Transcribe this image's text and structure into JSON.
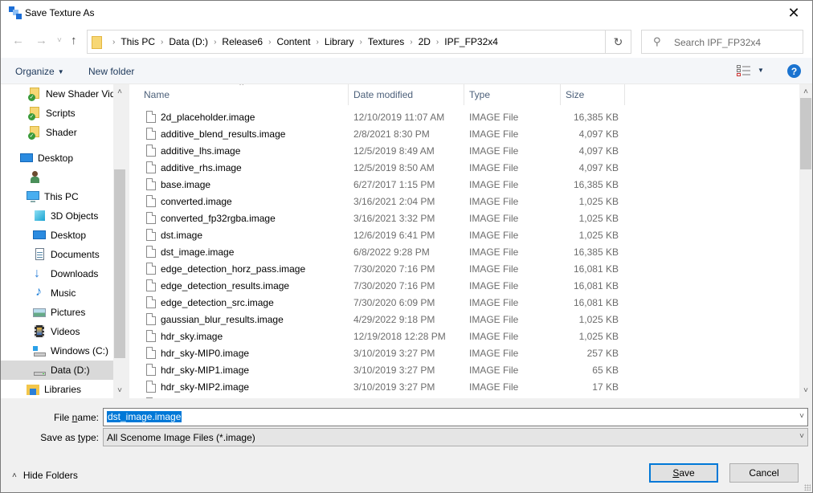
{
  "window": {
    "title": "Save Texture As",
    "close_label": "✕"
  },
  "nav": {
    "back_icon": "←",
    "forward_icon": "→",
    "recent_icon": "˅",
    "up_icon": "↑",
    "breadcrumbs": [
      "This PC",
      "Data (D:)",
      "Release6",
      "Content",
      "Library",
      "Textures",
      "2D",
      "IPF_FP32x4"
    ],
    "crumb_separator": "›",
    "dropdown_icon": "˅",
    "refresh_icon": "↻",
    "search_icon": "⚲",
    "search_placeholder": "Search IPF_FP32x4"
  },
  "toolbar": {
    "organize_label": "Organize",
    "organize_caret": "▼",
    "new_folder_label": "New folder",
    "view_caret": "▼",
    "help_label": "?"
  },
  "sidebar": {
    "items": [
      {
        "label": "New Shader Videos",
        "icon": "folder-synced-icon"
      },
      {
        "label": "Scripts",
        "icon": "folder-synced-icon"
      },
      {
        "label": "Shader",
        "icon": "folder-synced-icon"
      },
      {
        "label": "Desktop",
        "icon": "desktop-icon"
      },
      {
        "label": "",
        "icon": "user-icon"
      },
      {
        "label": "This PC",
        "icon": "computer-icon"
      },
      {
        "label": "3D Objects",
        "icon": "3d-objects-icon"
      },
      {
        "label": "Desktop",
        "icon": "desktop-icon"
      },
      {
        "label": "Documents",
        "icon": "documents-icon"
      },
      {
        "label": "Downloads",
        "icon": "downloads-icon"
      },
      {
        "label": "Music",
        "icon": "music-icon"
      },
      {
        "label": "Pictures",
        "icon": "pictures-icon"
      },
      {
        "label": "Videos",
        "icon": "videos-icon"
      },
      {
        "label": "Windows (C:)",
        "icon": "windows-drive-icon"
      },
      {
        "label": "Data (D:)",
        "icon": "drive-icon",
        "selected": true
      },
      {
        "label": "Libraries",
        "icon": "libraries-icon"
      }
    ],
    "scroll_up": "˄",
    "scroll_down": "˅"
  },
  "filelist": {
    "sort_caret": "˄",
    "columns": {
      "name": "Name",
      "date": "Date modified",
      "type": "Type",
      "size": "Size"
    },
    "files": [
      {
        "name": "2d_placeholder.image",
        "date": "12/10/2019 11:07 AM",
        "type": "IMAGE File",
        "size": "16,385 KB"
      },
      {
        "name": "additive_blend_results.image",
        "date": "2/8/2021 8:30 PM",
        "type": "IMAGE File",
        "size": "4,097 KB"
      },
      {
        "name": "additive_lhs.image",
        "date": "12/5/2019 8:49 AM",
        "type": "IMAGE File",
        "size": "4,097 KB"
      },
      {
        "name": "additive_rhs.image",
        "date": "12/5/2019 8:50 AM",
        "type": "IMAGE File",
        "size": "4,097 KB"
      },
      {
        "name": "base.image",
        "date": "6/27/2017 1:15 PM",
        "type": "IMAGE File",
        "size": "16,385 KB"
      },
      {
        "name": "converted.image",
        "date": "3/16/2021 2:04 PM",
        "type": "IMAGE File",
        "size": "1,025 KB"
      },
      {
        "name": "converted_fp32rgba.image",
        "date": "3/16/2021 3:32 PM",
        "type": "IMAGE File",
        "size": "1,025 KB"
      },
      {
        "name": "dst.image",
        "date": "12/6/2019 6:41 PM",
        "type": "IMAGE File",
        "size": "1,025 KB"
      },
      {
        "name": "dst_image.image",
        "date": "6/8/2022 9:28 PM",
        "type": "IMAGE File",
        "size": "16,385 KB"
      },
      {
        "name": "edge_detection_horz_pass.image",
        "date": "7/30/2020 7:16 PM",
        "type": "IMAGE File",
        "size": "16,081 KB"
      },
      {
        "name": "edge_detection_results.image",
        "date": "7/30/2020 7:16 PM",
        "type": "IMAGE File",
        "size": "16,081 KB"
      },
      {
        "name": "edge_detection_src.image",
        "date": "7/30/2020 6:09 PM",
        "type": "IMAGE File",
        "size": "16,081 KB"
      },
      {
        "name": "gaussian_blur_results.image",
        "date": "4/29/2022 9:18 PM",
        "type": "IMAGE File",
        "size": "1,025 KB"
      },
      {
        "name": "hdr_sky.image",
        "date": "12/19/2018 12:28 PM",
        "type": "IMAGE File",
        "size": "1,025 KB"
      },
      {
        "name": "hdr_sky-MIP0.image",
        "date": "3/10/2019 3:27 PM",
        "type": "IMAGE File",
        "size": "257 KB"
      },
      {
        "name": "hdr_sky-MIP1.image",
        "date": "3/10/2019 3:27 PM",
        "type": "IMAGE File",
        "size": "65 KB"
      },
      {
        "name": "hdr_sky-MIP2.image",
        "date": "3/10/2019 3:27 PM",
        "type": "IMAGE File",
        "size": "17 KB"
      }
    ],
    "scroll_up": "˄",
    "scroll_down": "˅"
  },
  "footer": {
    "file_name_label_pre": "File ",
    "file_name_label_u": "n",
    "file_name_label_post": "ame:",
    "file_name_value": "dst_image.image",
    "save_type_label_pre": "Save as ",
    "save_type_label_u": "t",
    "save_type_label_post": "ype:",
    "save_type_value": "All Scenome Image Files (*.image)",
    "dropdown_icon": "˅",
    "hide_folders_caret": "˄",
    "hide_folders_label": "Hide Folders",
    "save_u": "S",
    "save_rest": "ave",
    "cancel_label": "Cancel"
  },
  "colors": {
    "accent": "#0078d7",
    "selection_bg": "#0078d7",
    "header_text": "#4c607a",
    "secondary_text": "#6d6d6d",
    "help_blue": "#1a73d0",
    "folder_yellow": "#f7d774"
  }
}
